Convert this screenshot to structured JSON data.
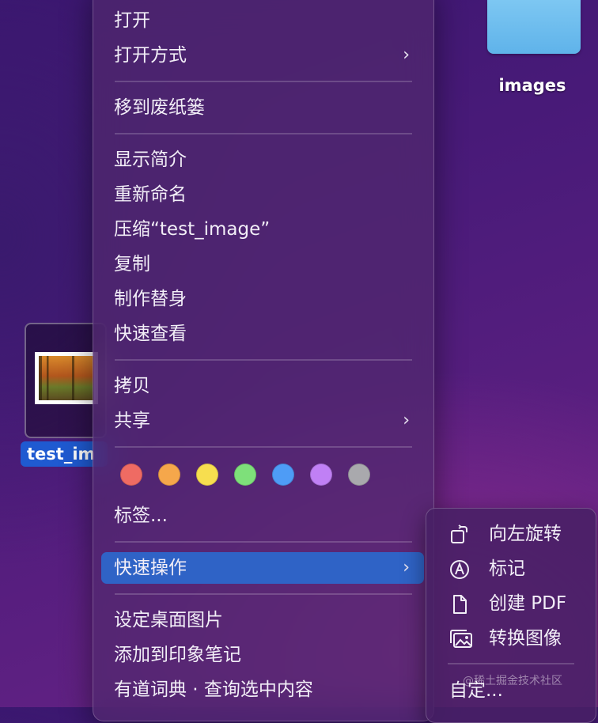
{
  "desktop": {
    "folder_label": "images",
    "file_label": "test_im"
  },
  "menu": {
    "open": "打开",
    "open_with": "打开方式",
    "move_to_trash": "移到废纸篓",
    "get_info": "显示简介",
    "rename": "重新命名",
    "compress": "压缩“test_image”",
    "duplicate": "复制",
    "make_alias": "制作替身",
    "quick_look": "快速查看",
    "copy": "拷贝",
    "share": "共享",
    "tags": "标签...",
    "quick_actions": "快速操作",
    "set_desktop": "设定桌面图片",
    "add_evernote": "添加到印象笔记",
    "youdao": "有道词典 · 查询选中内容",
    "chevron": "›"
  },
  "tag_colors": {
    "red": "#ef6b63",
    "orange": "#f5a74b",
    "yellow": "#f7de4f",
    "green": "#7ee07a",
    "blue": "#4e9cf6",
    "purple": "#c080f5",
    "gray": "#a9a9ad"
  },
  "submenu": {
    "rotate_left": "向左旋转",
    "markup": "标记",
    "create_pdf": "创建 PDF",
    "convert_image": "转换图像",
    "customize": "自定..."
  },
  "watermark": "@稀土掘金技术社区"
}
